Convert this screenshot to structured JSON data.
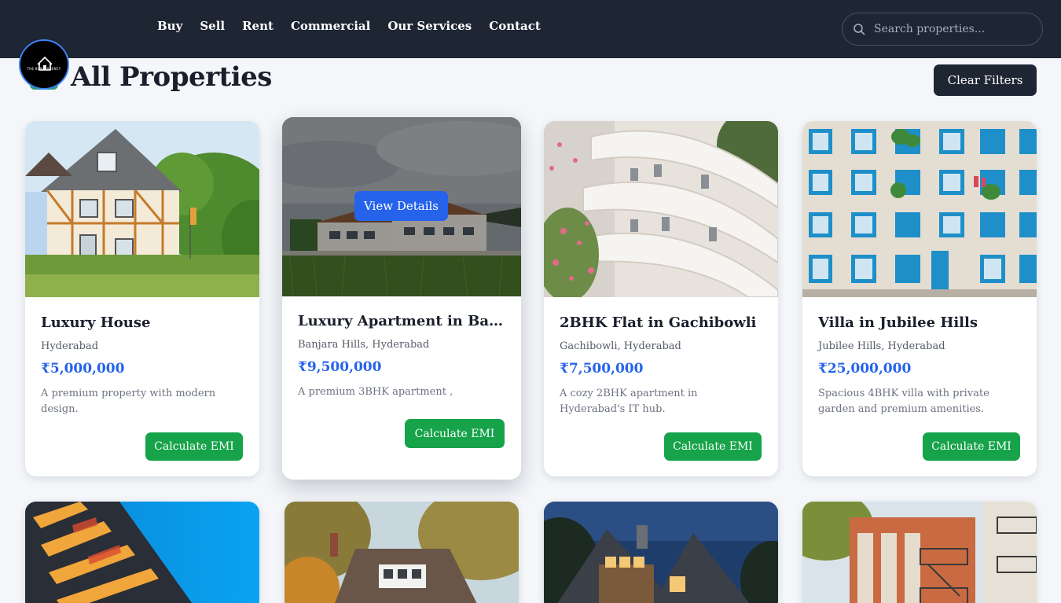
{
  "nav": {
    "links": [
      "Buy",
      "Sell",
      "Rent",
      "Commercial",
      "Our Services",
      "Contact"
    ],
    "search_placeholder": "Search properties..."
  },
  "logo": {
    "text": "THE BOMM AGENCY",
    "icon": "house-icon"
  },
  "page": {
    "title": "All Properties",
    "clear_filters": "Clear Filters"
  },
  "cards": [
    {
      "title": "Luxury House",
      "location": "Hyderabad",
      "price": "₹5,000,000",
      "description": "A premium property with modern design.",
      "emi": "Calculate EMI"
    },
    {
      "title": "Luxury Apartment in Banja...",
      "location": "Banjara Hills, Hyderabad",
      "price": "₹9,500,000",
      "description": "A premium 3BHK apartment ,",
      "emi": "Calculate EMI",
      "view_details": "View Details"
    },
    {
      "title": "2BHK Flat in Gachibowli",
      "location": "Gachibowli, Hyderabad",
      "price": "₹7,500,000",
      "description": "A cozy 2BHK apartment in Hyderabad's IT hub.",
      "emi": "Calculate EMI"
    },
    {
      "title": "Villa in Jubilee Hills",
      "location": "Jubilee Hills, Hyderabad",
      "price": "₹25,000,000",
      "description": "Spacious 4BHK villa with private garden and premium amenities.",
      "emi": "Calculate EMI"
    }
  ],
  "colors": {
    "navbar": "#1e2533",
    "price": "#2563eb",
    "emi": "#16a34a",
    "view": "#2563eb"
  }
}
